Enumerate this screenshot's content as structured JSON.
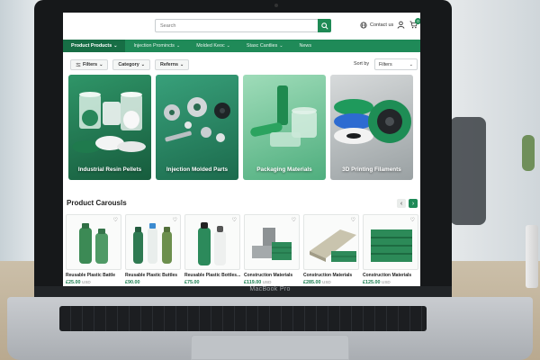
{
  "header": {
    "search_placeholder": "Search",
    "contact_label": "Contact us",
    "cart_count": "0"
  },
  "nav": {
    "items": [
      {
        "label": "Product Products"
      },
      {
        "label": "Injection Promincts"
      },
      {
        "label": "Molded Keoc"
      },
      {
        "label": "Stasc Cantlies"
      },
      {
        "label": "News"
      }
    ]
  },
  "filters": {
    "buttons": [
      {
        "label": "Filters"
      },
      {
        "label": "Category"
      },
      {
        "label": "Referns"
      }
    ],
    "sort_label": "Sort by",
    "sort_value": "Filters"
  },
  "categories": [
    {
      "label": "Industrial Resin Pellets"
    },
    {
      "label": "Injection Molded Parts"
    },
    {
      "label": "Packaging Materials"
    },
    {
      "label": "3D Printing Filaments"
    }
  ],
  "carousel": {
    "title": "Product Carousls",
    "products": [
      {
        "name": "Reusable Plastic Battle",
        "price": "£25.00",
        "currency": "USD"
      },
      {
        "name": "Reusable Plastic Buttles",
        "price": "£90.00",
        "currency": ""
      },
      {
        "name": "Reusable Plastic Bottles...",
        "price": "£75.00",
        "currency": ""
      },
      {
        "name": "Construction Materials",
        "price": "£119.00",
        "currency": "USD"
      },
      {
        "name": "Construction Materials",
        "price": "£285.00",
        "currency": "USD"
      },
      {
        "name": "Construction Materials",
        "price": "£125.00",
        "currency": "USD"
      }
    ]
  },
  "device": {
    "brand": "MacBook Pro"
  },
  "colors": {
    "brand_green": "#1f8a58",
    "nav_active": "#176e45"
  }
}
